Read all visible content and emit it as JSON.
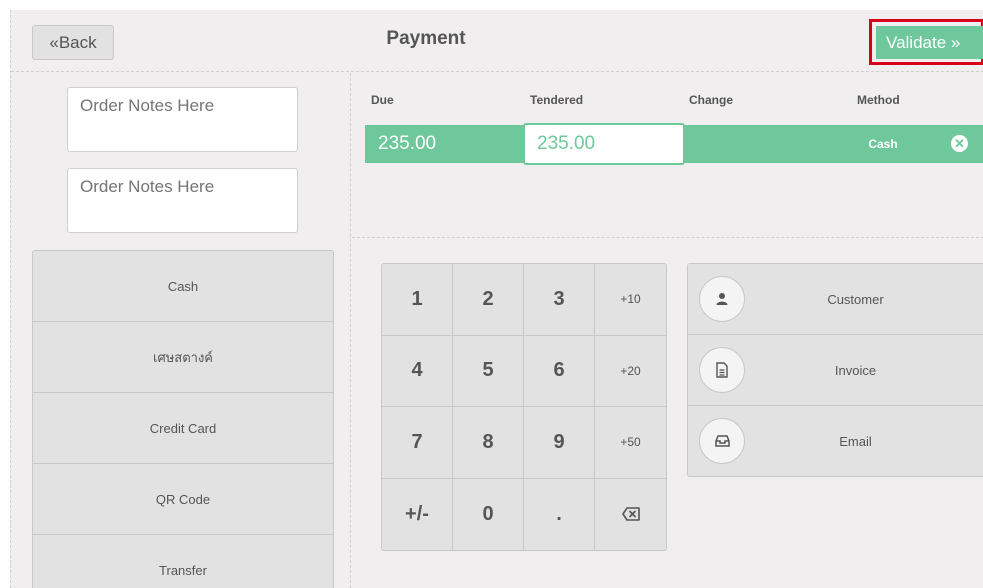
{
  "header": {
    "back_label": "«Back",
    "title": "Payment",
    "validate_label": "Validate »"
  },
  "notes": [
    {
      "placeholder": "Order Notes Here"
    },
    {
      "placeholder": "Order Notes Here"
    }
  ],
  "payment_methods": [
    "Cash",
    "เศษสตางค์",
    "Credit Card",
    "QR Code",
    "Transfer"
  ],
  "paymentlines": {
    "columns": [
      "Due",
      "Tendered",
      "Change",
      "Method"
    ],
    "line": {
      "due": "235.00",
      "tendered": "235.00",
      "change": "",
      "method": "Cash"
    }
  },
  "numpad": [
    "1",
    "2",
    "3",
    "+10",
    "4",
    "5",
    "6",
    "+20",
    "7",
    "8",
    "9",
    "+50",
    "+/-",
    "0",
    ".",
    "⌫"
  ],
  "actions": [
    {
      "label": "Customer",
      "icon": "user-icon"
    },
    {
      "label": "Invoice",
      "icon": "document-icon"
    },
    {
      "label": "Email",
      "icon": "inbox-icon"
    }
  ],
  "colors": {
    "accent": "#6ec89b",
    "highlight": "#d9001b",
    "button": "#e2e2e2",
    "background": "#f0eeee"
  }
}
